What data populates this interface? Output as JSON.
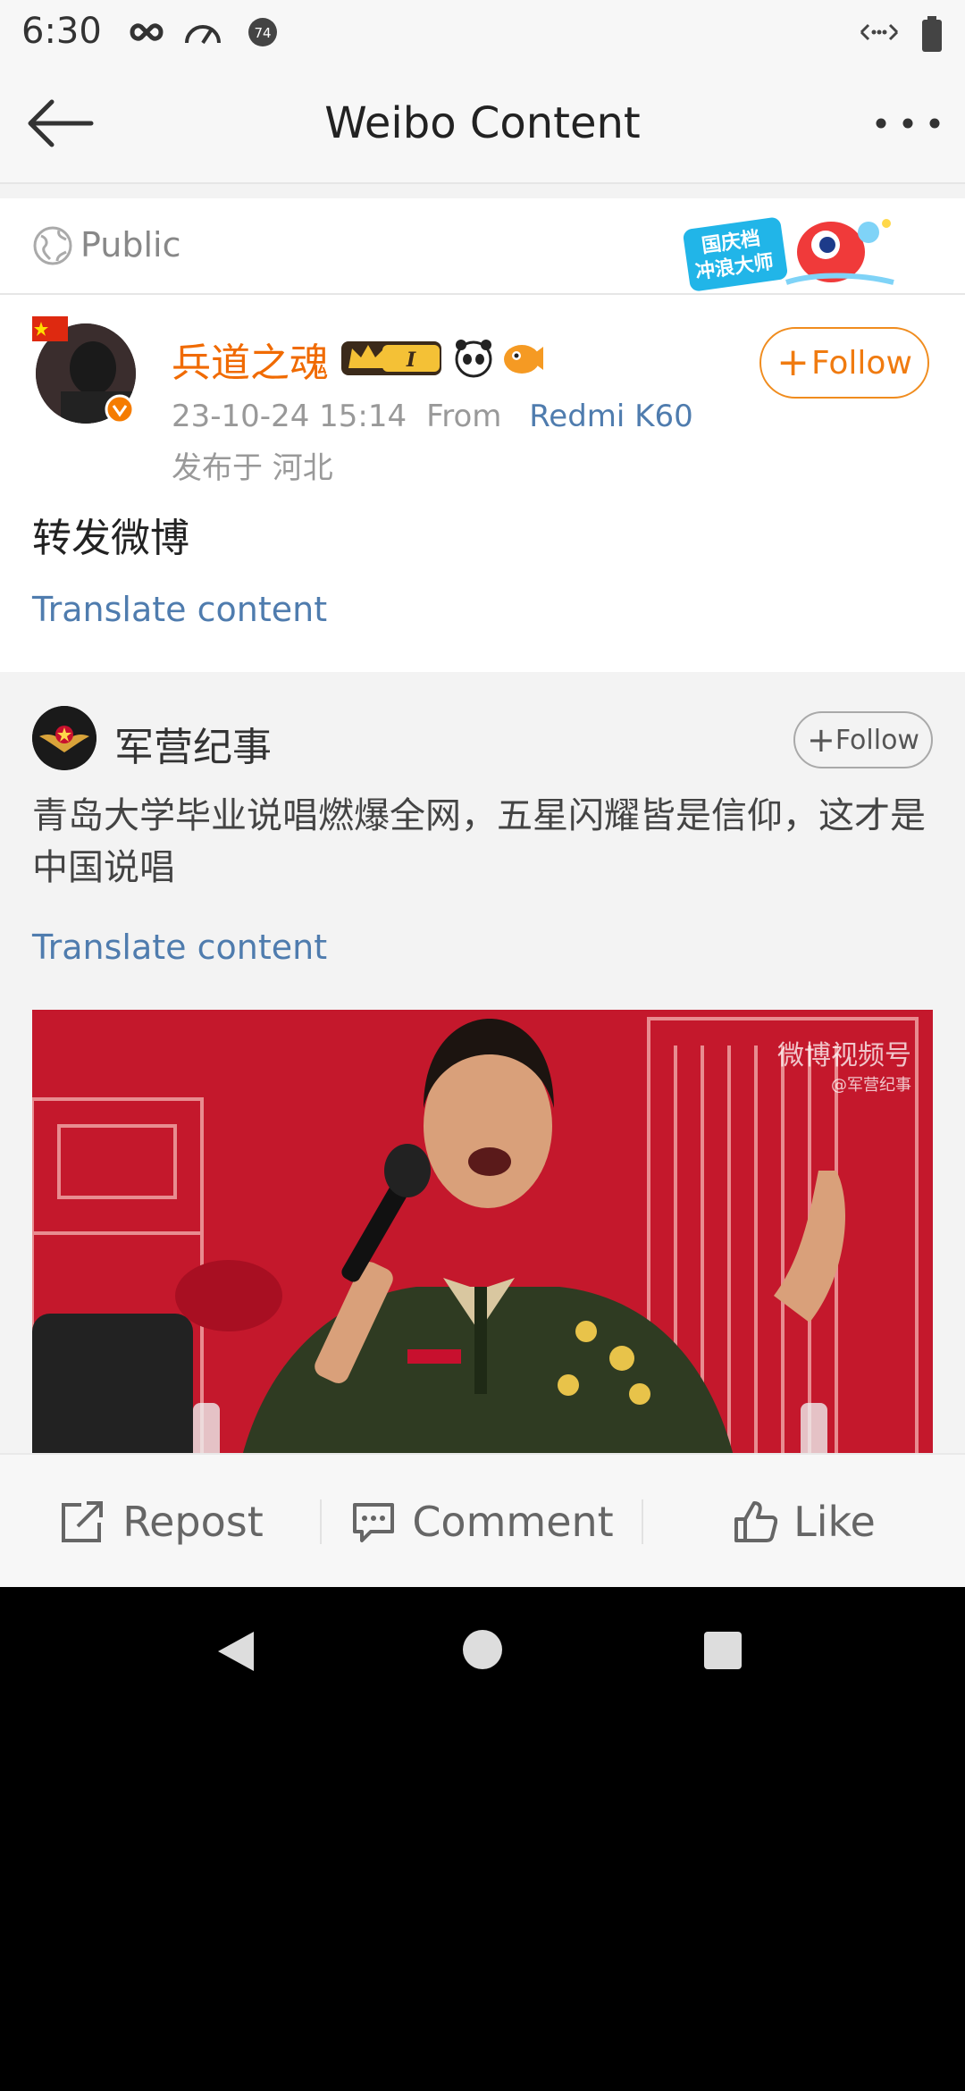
{
  "status_bar": {
    "time": "6:30",
    "icons": [
      "infinity-icon",
      "speedometer-icon",
      "notification-74-icon",
      "data-arrows-icon",
      "battery-icon"
    ],
    "badge_number": "74"
  },
  "nav": {
    "title": "Weibo Content",
    "back_icon": "back-arrow-icon",
    "more_icon": "more-dots-icon"
  },
  "visibility": {
    "label": "Public",
    "icon": "globe-icon",
    "promo_badge_text": [
      "国庆档",
      "冲浪大师"
    ]
  },
  "post": {
    "username": "兵道之魂",
    "badge_level": "I",
    "follow_label": "Follow",
    "timestamp": "23-10-24 15:14",
    "from_label": "From",
    "source": "Redmi K60",
    "location": "发布于 河北",
    "text": "转发微博",
    "translate_label": "Translate content"
  },
  "retweet": {
    "author": "军营纪事",
    "follow_label": "Follow",
    "text": "青岛大学毕业说唱燃爆全网，五星闪耀皆是信仰，这才是中国说唱",
    "translate_label": "Translate content",
    "video_watermark": "微博视频号",
    "video_handle": "@军营纪事"
  },
  "actions": {
    "repost": "Repost",
    "comment": "Comment",
    "like": "Like"
  },
  "colors": {
    "username": "#f06a00",
    "link": "#4f7cae",
    "follow_border": "#f08c1e"
  }
}
